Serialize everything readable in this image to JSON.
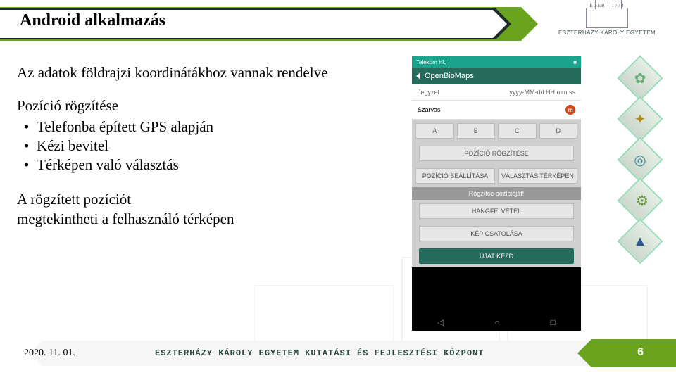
{
  "header": {
    "title": "Android alkalmazás"
  },
  "logo": {
    "line1": "ESZTERHÁZY KÁROLY EGYETEM",
    "crest_top": "EGER · 1774"
  },
  "content": {
    "intro": "Az adatok földrajzi koordinátákhoz vannak rendelve",
    "section1_heading": "Pozíció rögzítése",
    "bullets": [
      "Telefonba épített GPS alapján",
      "Kézi bevitel",
      "Térképen való választás"
    ],
    "section2": "A rögzített pozíciót\nmegtekintheti a felhasználó térképen"
  },
  "phone": {
    "carrier": "Telekom HU",
    "battery": "■",
    "app_name": "OpenBioMaps",
    "note_label": "Jegyzet",
    "date_placeholder": "yyyy-MM-dd HH:mm:ss",
    "input_value": "Szarvas",
    "opts": [
      "A",
      "B",
      "C",
      "D"
    ],
    "btn_record": "POZÍCIÓ RÖGZÍTÉSE",
    "btn_set": "POZÍCIÓ BEÁLLÍTÁSA",
    "btn_map": "VÁLASZTÁS TÉRKÉPEN",
    "hint": "Rögzítse pozícióját!",
    "btn_audio": "HANGFELVÉTEL",
    "btn_photo": "KÉP CSATOLÁSA",
    "btn_new": "ÚJAT KEZD"
  },
  "footer": {
    "date": "2020. 11. 01.",
    "center": "ESZTERHÁZY KÁROLY EGYETEM  KUTATÁSI ÉS FEJLESZTÉSI KÖZPONT",
    "page": "6"
  }
}
